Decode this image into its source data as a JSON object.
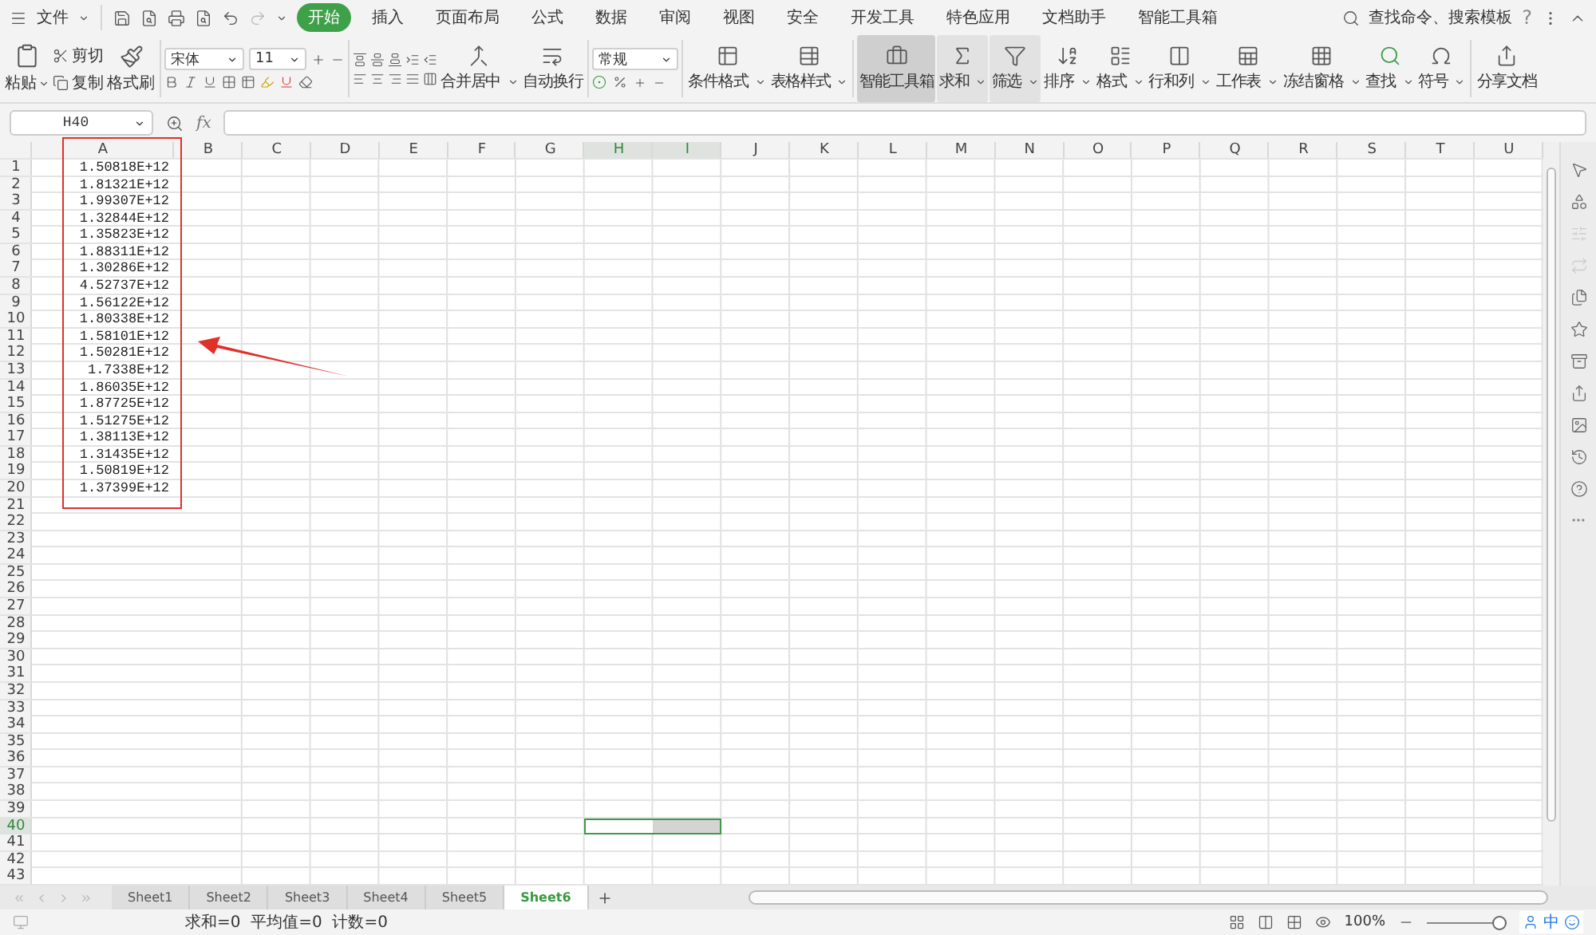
{
  "menu": {
    "file": "文件",
    "tabs": [
      {
        "label": "开始",
        "selected": true
      },
      {
        "label": "插入",
        "selected": false
      },
      {
        "label": "页面布局",
        "selected": false
      },
      {
        "label": "公式",
        "selected": false
      },
      {
        "label": "数据",
        "selected": false
      },
      {
        "label": "审阅",
        "selected": false
      },
      {
        "label": "视图",
        "selected": false
      },
      {
        "label": "安全",
        "selected": false
      },
      {
        "label": "开发工具",
        "selected": false
      },
      {
        "label": "特色应用",
        "selected": false
      },
      {
        "label": "文档助手",
        "selected": false
      },
      {
        "label": "智能工具箱",
        "selected": false
      }
    ],
    "search": "查找命令、搜索模板",
    "help": "?"
  },
  "ribbon": {
    "paste": "粘贴",
    "cut": "剪切",
    "copy": "复制",
    "format_painter": "格式刷",
    "font_name": "宋体",
    "font_size": "11",
    "merge": "合并居中",
    "wrap": "自动换行",
    "number_format": "常规",
    "tools": [
      {
        "label": "条件格式",
        "dropdown": true,
        "pressed": false,
        "hovered": false
      },
      {
        "label": "表格样式",
        "dropdown": true,
        "pressed": false,
        "hovered": false
      },
      {
        "label": "智能工具箱",
        "dropdown": false,
        "pressed": true,
        "hovered": false
      },
      {
        "label": "求和",
        "dropdown": true,
        "pressed": false,
        "hovered": true
      },
      {
        "label": "筛选",
        "dropdown": true,
        "pressed": false,
        "hovered": true
      },
      {
        "label": "排序",
        "dropdown": true,
        "pressed": false,
        "hovered": false
      },
      {
        "label": "格式",
        "dropdown": true,
        "pressed": false,
        "hovered": false
      },
      {
        "label": "行和列",
        "dropdown": true,
        "pressed": false,
        "hovered": false
      },
      {
        "label": "工作表",
        "dropdown": true,
        "pressed": false,
        "hovered": false
      },
      {
        "label": "冻结窗格",
        "dropdown": true,
        "pressed": false,
        "hovered": false
      },
      {
        "label": "查找",
        "dropdown": true,
        "pressed": false,
        "hovered": false
      },
      {
        "label": "符号",
        "dropdown": true,
        "pressed": false,
        "hovered": false
      },
      {
        "label": "分享文档",
        "dropdown": false,
        "pressed": false,
        "hovered": false
      }
    ]
  },
  "name_box": "H40",
  "fx": "fx",
  "columns": [
    {
      "label": "A",
      "selected": false
    },
    {
      "label": "B",
      "selected": false
    },
    {
      "label": "C",
      "selected": false
    },
    {
      "label": "D",
      "selected": false
    },
    {
      "label": "E",
      "selected": false
    },
    {
      "label": "F",
      "selected": false
    },
    {
      "label": "G",
      "selected": false
    },
    {
      "label": "H",
      "selected": true
    },
    {
      "label": "I",
      "selected": true
    },
    {
      "label": "J",
      "selected": false
    },
    {
      "label": "K",
      "selected": false
    },
    {
      "label": "L",
      "selected": false
    },
    {
      "label": "M",
      "selected": false
    },
    {
      "label": "N",
      "selected": false
    },
    {
      "label": "O",
      "selected": false
    },
    {
      "label": "P",
      "selected": false
    },
    {
      "label": "Q",
      "selected": false
    },
    {
      "label": "R",
      "selected": false
    },
    {
      "label": "S",
      "selected": false
    },
    {
      "label": "T",
      "selected": false
    },
    {
      "label": "U",
      "selected": false
    }
  ],
  "rows": [
    {
      "label": "1",
      "selected": false,
      "a": "1.50818E+12"
    },
    {
      "label": "2",
      "selected": false,
      "a": "1.81321E+12"
    },
    {
      "label": "3",
      "selected": false,
      "a": "1.99307E+12"
    },
    {
      "label": "4",
      "selected": false,
      "a": "1.32844E+12"
    },
    {
      "label": "5",
      "selected": false,
      "a": "1.35823E+12"
    },
    {
      "label": "6",
      "selected": false,
      "a": "1.88311E+12"
    },
    {
      "label": "7",
      "selected": false,
      "a": "1.30286E+12"
    },
    {
      "label": "8",
      "selected": false,
      "a": "4.52737E+12"
    },
    {
      "label": "9",
      "selected": false,
      "a": "1.56122E+12"
    },
    {
      "label": "10",
      "selected": false,
      "a": "1.80338E+12"
    },
    {
      "label": "11",
      "selected": false,
      "a": "1.58101E+12"
    },
    {
      "label": "12",
      "selected": false,
      "a": "1.50281E+12"
    },
    {
      "label": "13",
      "selected": false,
      "a": "1.7338E+12"
    },
    {
      "label": "14",
      "selected": false,
      "a": "1.86035E+12"
    },
    {
      "label": "15",
      "selected": false,
      "a": "1.87725E+12"
    },
    {
      "label": "16",
      "selected": false,
      "a": "1.51275E+12"
    },
    {
      "label": "17",
      "selected": false,
      "a": "1.38113E+12"
    },
    {
      "label": "18",
      "selected": false,
      "a": "1.31435E+12"
    },
    {
      "label": "19",
      "selected": false,
      "a": "1.50819E+12"
    },
    {
      "label": "20",
      "selected": false,
      "a": "1.37399E+12"
    },
    {
      "label": "21",
      "selected": false
    },
    {
      "label": "22",
      "selected": false
    },
    {
      "label": "23",
      "selected": false
    },
    {
      "label": "24",
      "selected": false
    },
    {
      "label": "25",
      "selected": false
    },
    {
      "label": "26",
      "selected": false
    },
    {
      "label": "27",
      "selected": false
    },
    {
      "label": "28",
      "selected": false
    },
    {
      "label": "29",
      "selected": false
    },
    {
      "label": "30",
      "selected": false
    },
    {
      "label": "31",
      "selected": false
    },
    {
      "label": "32",
      "selected": false
    },
    {
      "label": "33",
      "selected": false
    },
    {
      "label": "34",
      "selected": false
    },
    {
      "label": "35",
      "selected": false
    },
    {
      "label": "36",
      "selected": false
    },
    {
      "label": "37",
      "selected": false
    },
    {
      "label": "38",
      "selected": false
    },
    {
      "label": "39",
      "selected": false
    },
    {
      "label": "40",
      "selected": true
    },
    {
      "label": "41",
      "selected": false
    },
    {
      "label": "42",
      "selected": false
    },
    {
      "label": "43",
      "selected": false
    }
  ],
  "sheets": [
    {
      "label": "Sheet1",
      "selected": false
    },
    {
      "label": "Sheet2",
      "selected": false
    },
    {
      "label": "Sheet3",
      "selected": false
    },
    {
      "label": "Sheet4",
      "selected": false
    },
    {
      "label": "Sheet5",
      "selected": false
    },
    {
      "label": "Sheet6",
      "selected": true
    }
  ],
  "status": {
    "summary": "求和=0  平均值=0  计数=0",
    "zoom": "100%",
    "zoom_slider": {
      "level": 1
    },
    "ime": "中"
  }
}
